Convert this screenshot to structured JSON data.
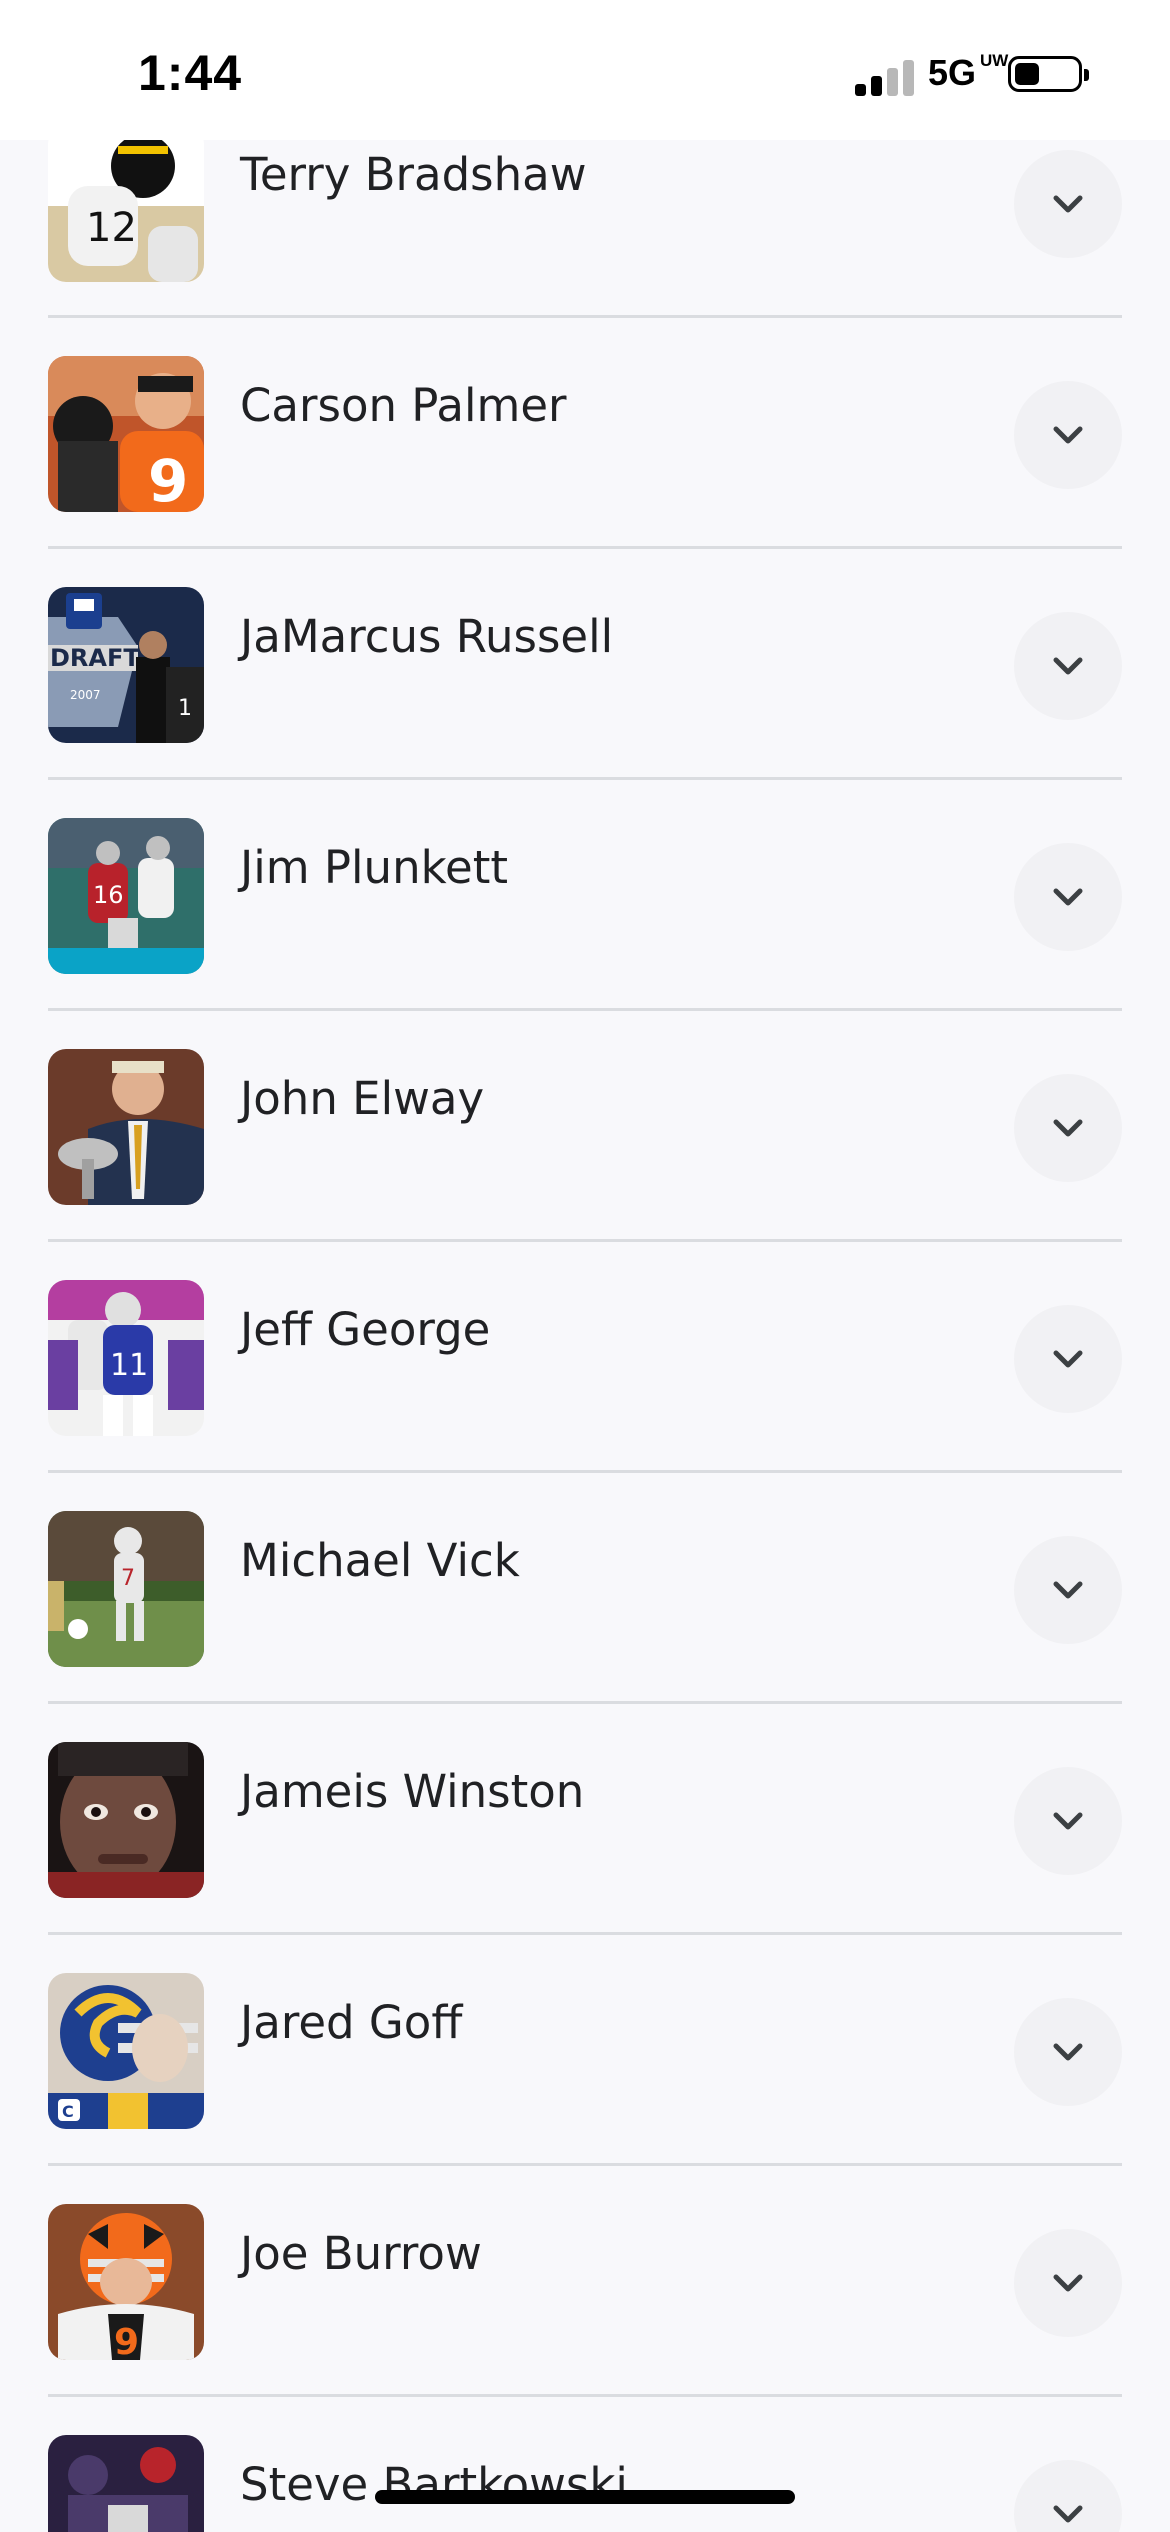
{
  "status_bar": {
    "time": "1:44",
    "network": "5G",
    "network_badge": "UW",
    "signal_bars_active": 2,
    "signal_bars_total": 4,
    "battery_level": 0.4
  },
  "players": [
    {
      "name": "Terry Bradshaw",
      "thumb_colors": [
        "#d9c9a3",
        "#111111",
        "#f2c200",
        "#ffffff"
      ]
    },
    {
      "name": "Carson Palmer",
      "thumb_colors": [
        "#c0552a",
        "#f26a1b",
        "#1a1a1a",
        "#e8e2d8"
      ]
    },
    {
      "name": "JaMarcus Russell",
      "thumb_colors": [
        "#1b2a4a",
        "#8a9bb5",
        "#d9d9d9",
        "#101010"
      ]
    },
    {
      "name": "Jim Plunkett",
      "thumb_colors": [
        "#2f6f6a",
        "#b8222b",
        "#f1f1f1",
        "#0aa3c7"
      ]
    },
    {
      "name": "John Elway",
      "thumb_colors": [
        "#6b3b2a",
        "#23324f",
        "#d8c07a",
        "#f0f0f0"
      ]
    },
    {
      "name": "Jeff George",
      "thumb_colors": [
        "#b43ea0",
        "#2a3aa8",
        "#f2f2f2",
        "#6a3fa1"
      ]
    },
    {
      "name": "Michael Vick",
      "thumb_colors": [
        "#3d5d2a",
        "#e8e8e8",
        "#b8242b",
        "#c9b36a"
      ]
    },
    {
      "name": "Jameis Winston",
      "thumb_colors": [
        "#3a2a25",
        "#6e4a3e",
        "#8a2424",
        "#1a1414"
      ]
    },
    {
      "name": "Jared Goff",
      "thumb_colors": [
        "#1e3f8f",
        "#f2c230",
        "#e6d2c0",
        "#0e1a3a"
      ]
    },
    {
      "name": "Joe Burrow",
      "thumb_colors": [
        "#f26a1b",
        "#1a1a1a",
        "#f2f2f2",
        "#8a4a2a"
      ]
    },
    {
      "name": "Steve Bartkowski",
      "thumb_colors": [
        "#2a2040",
        "#b8242b",
        "#4a3a6a",
        "#d9d9d9"
      ]
    }
  ]
}
